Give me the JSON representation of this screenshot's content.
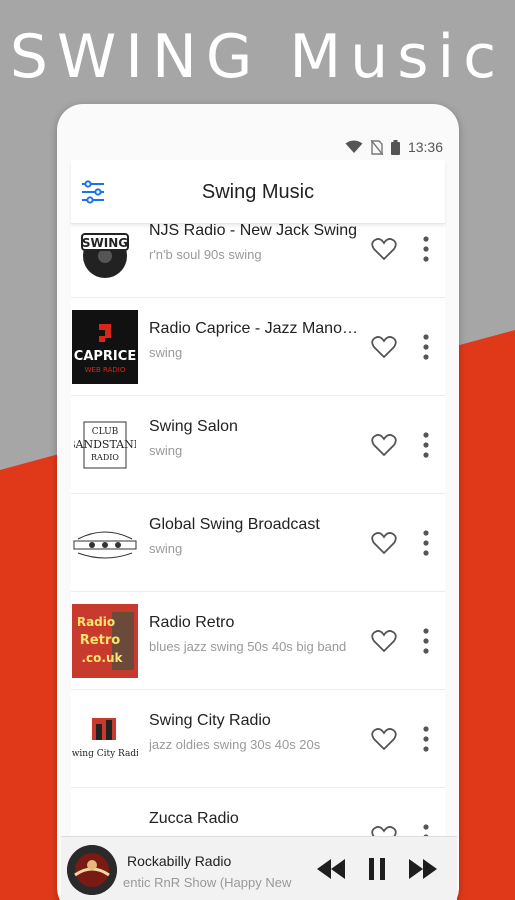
{
  "promo": {
    "title": "SWING Music"
  },
  "status": {
    "time": "13:36"
  },
  "app_bar": {
    "title": "Swing Music",
    "menu_icon": "equalizer-sliders-icon"
  },
  "colors": {
    "accent_red": "#e0391a",
    "background_gray": "#a6a6a6",
    "icon_blue": "#1a73e8",
    "text_primary": "#222222",
    "text_secondary": "#9a9a9a"
  },
  "stations": [
    {
      "name": "NJS Radio - New Jack Swing",
      "tags": "r'n'b soul 90s swing",
      "logo_icon": "njs-swing-logo"
    },
    {
      "name": "Radio Caprice - Jazz Manouche",
      "tags": "swing",
      "logo_icon": "caprice-web-radio-logo"
    },
    {
      "name": "Swing Salon",
      "tags": "swing",
      "logo_icon": "club-bandstand-logo"
    },
    {
      "name": "Global Swing Broadcast",
      "tags": "swing",
      "logo_icon": "global-swing-logo"
    },
    {
      "name": "Radio Retro",
      "tags": "blues jazz swing 50s 40s big band",
      "logo_icon": "radio-retro-logo"
    },
    {
      "name": "Swing City Radio",
      "tags": "jazz oldies swing 30s 40s 20s",
      "logo_icon": "swing-city-logo"
    },
    {
      "name": "Zucca Radio",
      "tags": "",
      "logo_icon": "zucca-logo"
    }
  ],
  "player": {
    "title": "Rockabilly Radio",
    "subtitle": "entic RnR Show (Happy New",
    "art_icon": "rockabilly-radio-logo"
  }
}
